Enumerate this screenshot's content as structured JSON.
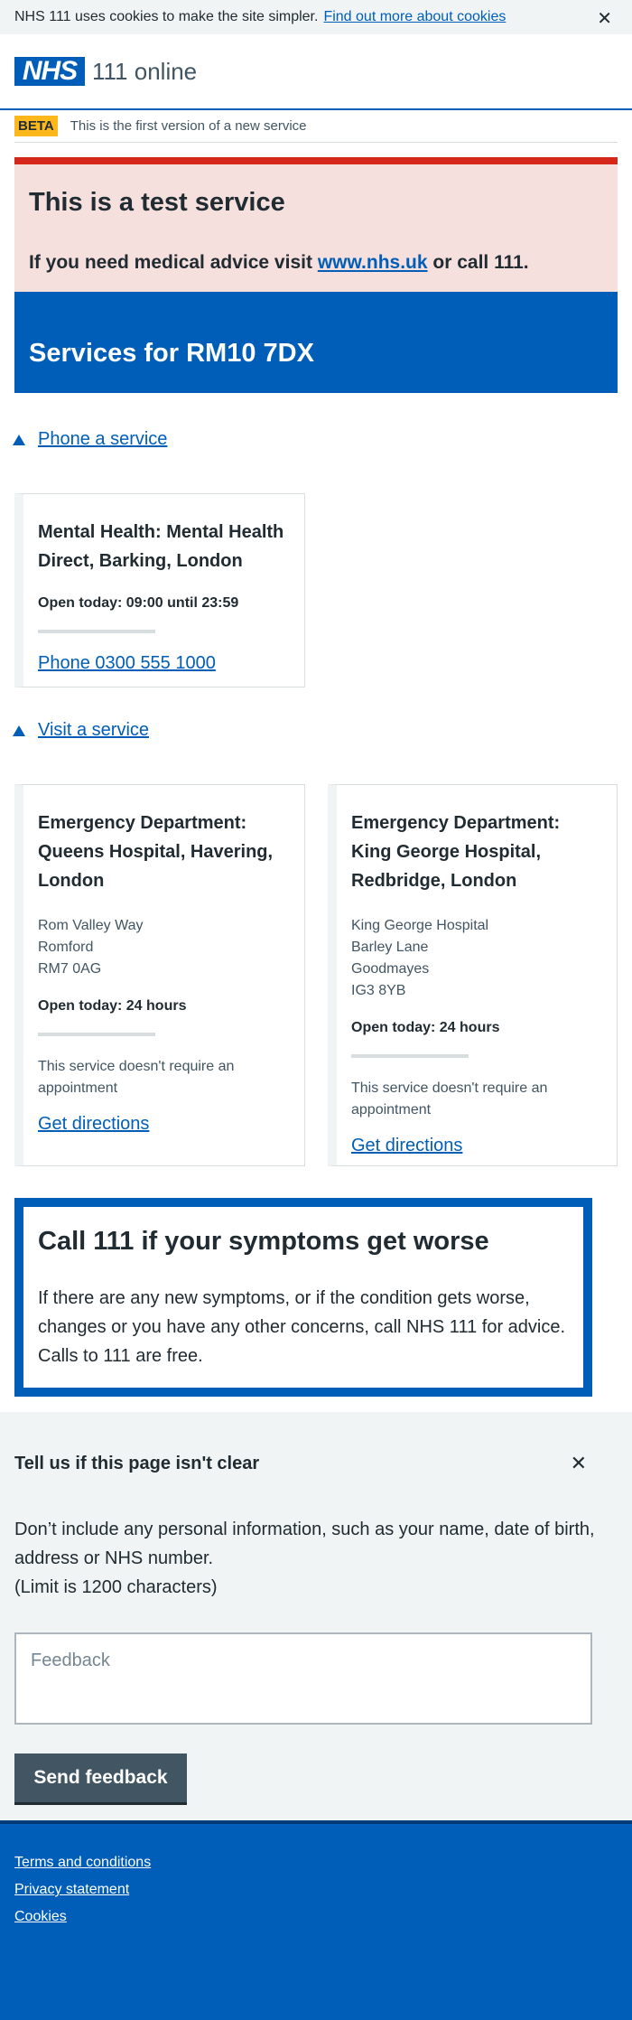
{
  "cookie_banner": {
    "text": "NHS 111 uses cookies to make the site simpler.",
    "link": "Find out more about cookies",
    "close": "✕"
  },
  "header": {
    "logo": "NHS",
    "service_name": "111 online"
  },
  "beta": {
    "tag": "BETA",
    "text": "This is the first version of a new service"
  },
  "test_notice": {
    "title": "This is a test service",
    "text_before": "If you need medical advice visit",
    "link": "www.nhs.uk",
    "text_after": "or call 111."
  },
  "services": {
    "title": "Services for RM10 7DX"
  },
  "phone_section": {
    "toggle": "Phone a service",
    "cards": [
      {
        "title": "Mental Health: Mental Health Direct, Barking, London",
        "open": "Open today: 09:00 until 23:59",
        "action": "Phone 0300 555 1000"
      }
    ]
  },
  "visit_section": {
    "toggle": "Visit a service",
    "cards": [
      {
        "title": "Emergency Department: Queens Hospital, Havering, London",
        "address": [
          "Rom Valley Way",
          "Romford",
          "RM7 0AG"
        ],
        "open": "Open today: 24 hours",
        "note": "This service doesn't require an appointment",
        "action": "Get directions"
      },
      {
        "title": "Emergency Department: King George Hospital, Redbridge, London",
        "address": [
          "King George Hospital",
          "Barley Lane",
          "Goodmayes",
          "IG3 8YB"
        ],
        "open": "Open today: 24 hours",
        "note": "This service doesn't require an appointment",
        "action": "Get directions"
      }
    ]
  },
  "care_advice": {
    "title": "Call 111 if your symptoms get worse",
    "text": "If there are any new symptoms, or if the condition gets worse, changes or you have any other concerns, call NHS 111 for advice. Calls to 111 are free."
  },
  "feedback": {
    "title": "Tell us if this page isn't clear",
    "close": "✕",
    "text": "Don’t include any personal information, such as your name, date of birth, address or NHS number.",
    "limit": "(Limit is 1200 characters)",
    "placeholder": "Feedback",
    "button": "Send feedback"
  },
  "footer": {
    "links": [
      "Terms and conditions",
      "Privacy statement",
      "Cookies"
    ]
  },
  "colors": {
    "nhs_blue": "#005eb8",
    "warning_red": "#d5281b",
    "warning_bg": "#f6e0de",
    "beta_yellow": "#ffb81c",
    "grey_bg": "#f0f4f5",
    "button_grey": "#425563"
  }
}
